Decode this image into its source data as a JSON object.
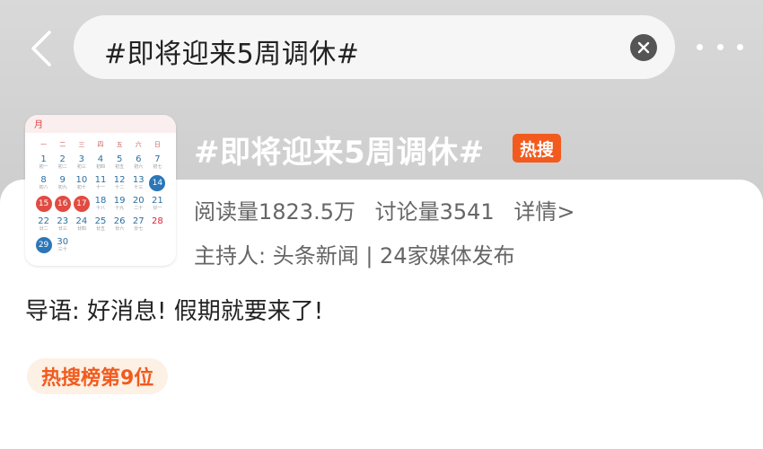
{
  "header": {
    "search_query": "#即将迎来5周调休#"
  },
  "topic": {
    "title": "#即将迎来5周调休#",
    "hot_tag": "热搜",
    "reads": "阅读量1823.5万",
    "discussions": "讨论量3541",
    "details_link": "详情>",
    "host": "主持人: 头条新闻 | 24家媒体发布",
    "intro": "导语: 好消息! 假期就要来了!",
    "rank": "热搜榜第9位"
  },
  "thumbnail": {
    "month_label": "月",
    "weekdays": [
      "一",
      "二",
      "三",
      "四",
      "五",
      "六",
      "日"
    ],
    "days": [
      {
        "d": "1",
        "s": "初一"
      },
      {
        "d": "2",
        "s": "初二"
      },
      {
        "d": "3",
        "s": "初三"
      },
      {
        "d": "4",
        "s": "初四"
      },
      {
        "d": "5",
        "s": "初五"
      },
      {
        "d": "6",
        "s": "初六"
      },
      {
        "d": "7",
        "s": "初七"
      },
      {
        "d": "8",
        "s": "初八"
      },
      {
        "d": "9",
        "s": "初九"
      },
      {
        "d": "10",
        "s": "初十"
      },
      {
        "d": "11",
        "s": "十一"
      },
      {
        "d": "12",
        "s": "十二"
      },
      {
        "d": "13",
        "s": "十三"
      },
      {
        "d": "14",
        "s": "十四",
        "t": "work"
      },
      {
        "d": "15",
        "s": "",
        "t": "hol"
      },
      {
        "d": "16",
        "s": "",
        "t": "hol"
      },
      {
        "d": "17",
        "s": "",
        "t": "hol"
      },
      {
        "d": "18",
        "s": "十八"
      },
      {
        "d": "19",
        "s": "十九"
      },
      {
        "d": "20",
        "s": "二十"
      },
      {
        "d": "21",
        "s": "廿一"
      },
      {
        "d": "22",
        "s": "廿二"
      },
      {
        "d": "23",
        "s": "廿三"
      },
      {
        "d": "24",
        "s": "廿四"
      },
      {
        "d": "25",
        "s": "廿五"
      },
      {
        "d": "26",
        "s": "廿六"
      },
      {
        "d": "27",
        "s": "廿七"
      },
      {
        "d": "28",
        "s": "廿八",
        "t": "red"
      },
      {
        "d": "29",
        "s": "",
        "t": "work"
      },
      {
        "d": "30",
        "s": "三十"
      }
    ]
  },
  "colors": {
    "hot_orange": "#f25a1e",
    "rank_bg": "#fdf0e4",
    "holiday_red": "#e14b42",
    "workday_blue": "#2a76b8"
  }
}
